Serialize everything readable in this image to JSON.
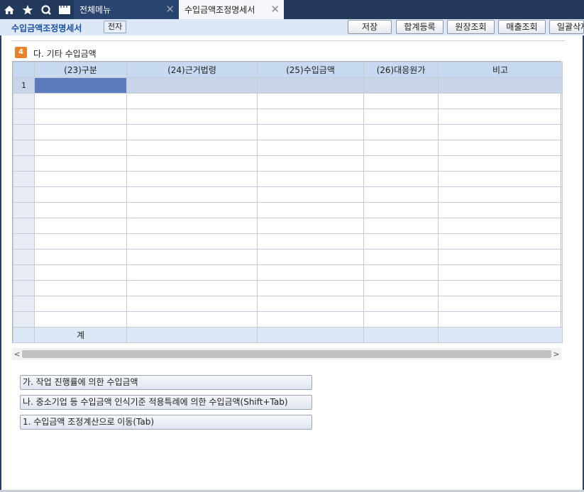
{
  "topbar": {
    "tabs": [
      {
        "label": "전체메뉴",
        "active": false
      },
      {
        "label": "수입금액조정명세서",
        "active": true
      }
    ],
    "close_glyph": "✕"
  },
  "title": {
    "text": "수입금액조정명세서",
    "badge": "전자"
  },
  "toolbar": {
    "save": "저장",
    "summary": "합계등록",
    "ledger": "원장조회",
    "sales": "매출조회",
    "bulk": "일괄삭제"
  },
  "section": {
    "number": "4",
    "title": "다. 기타 수입금액"
  },
  "grid": {
    "columns": [
      "(23)구분",
      "(24)근거법령",
      "(25)수입금액",
      "(26)대응원가",
      "비고"
    ],
    "first_row_number": "1",
    "total_label": "계"
  },
  "buttons": {
    "progress": "가. 작업 진행률에 의한 수입금액",
    "sme": "나. 중소기업 등 수입금액 인식기준 적용특례에 의한 수입금액(Shift+Tab)",
    "move": "1. 수입금액 조정계산으로 이동(Tab)"
  },
  "scrollbar": {
    "left_arrow": "<",
    "right_arrow": ">"
  },
  "colors": {
    "topbar": "#23395c",
    "title_text": "#1a4f9c",
    "header_bg": "#c6d9f0",
    "selected_cell": "#5b7bbd",
    "section_badge": "#e8812c"
  }
}
